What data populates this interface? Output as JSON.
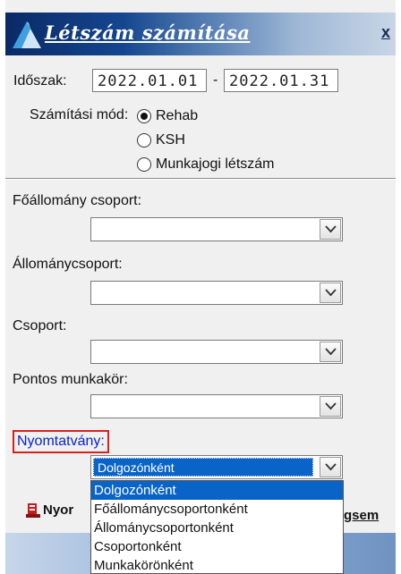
{
  "window": {
    "title": "Létszám számítása",
    "close_label": "x"
  },
  "period": {
    "label": "Időszak:",
    "from": "2022.01.01",
    "separator": "-",
    "to": "2022.01.31"
  },
  "calc_mode": {
    "label": "Számítási mód:",
    "options": [
      "Rehab",
      "KSH",
      "Munkajogi létszám"
    ],
    "selected": "Rehab"
  },
  "filters": {
    "foallomany_label": "Főállomány csoport:",
    "allomanycsoport_label": "Állománycsoport:",
    "csoport_label": "Csoport:",
    "munkakor_label": "Pontos munkakör:"
  },
  "print_form": {
    "label": "Nyomtatvány:",
    "value": "Dolgozónként",
    "options": [
      "Dolgozónként",
      "Főállománycsoportonként",
      "Állománycsoportonként",
      "Csoportonként",
      "Munkakörönként"
    ]
  },
  "buttons": {
    "print_partial": "Nyor",
    "cancel_partial": "gsem"
  },
  "icons": [
    "app-logo-icon",
    "chevron-down-icon",
    "print-icon"
  ],
  "colors": {
    "selection": "#0a64c8",
    "highlight_border": "#d82020",
    "link_label": "#0b24c8"
  }
}
